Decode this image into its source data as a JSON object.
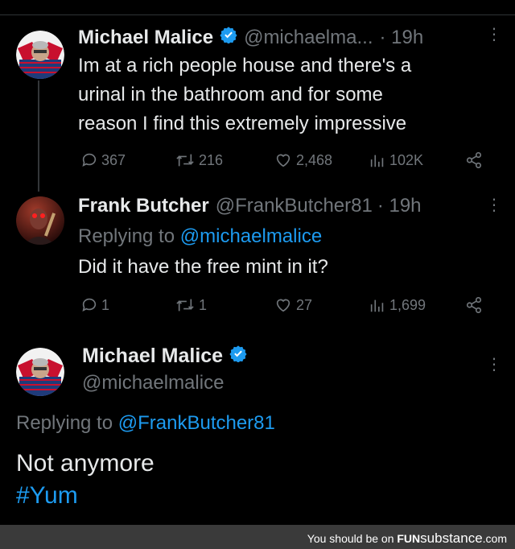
{
  "tweet1": {
    "name": "Michael Malice",
    "handle": "@michaelma...",
    "time": "· 19h",
    "text_lines": [
      "Im at a rich people house and there's a",
      "urinal in the bathroom and for some",
      "reason I find this extremely impressive"
    ],
    "replies": "367",
    "retweets": "216",
    "likes": "2,468",
    "views": "102K"
  },
  "tweet2": {
    "name": "Frank Butcher",
    "handle": "@FrankButcher81",
    "time": "· 19h",
    "replying_prefix": "Replying to",
    "replying_handle": "@michaelmalice",
    "text": "Did it have the free mint in it?",
    "replies": "1",
    "retweets": "1",
    "likes": "27",
    "views": "1,699"
  },
  "tweet3": {
    "name": "Michael Malice",
    "handle": "@michaelmalice",
    "replying_prefix": "Replying to",
    "replying_handle": "@FrankButcher81",
    "text": "Not anymore",
    "hashtag": "#Yum"
  },
  "footer": {
    "prefix": "You should be on",
    "brand_a": "FUN",
    "brand_b": "substance",
    "brand_c": ".com"
  },
  "colors": {
    "background": "#000000",
    "accent": "#1d9bf0",
    "muted": "#71767b",
    "text": "#e7e9ea"
  }
}
